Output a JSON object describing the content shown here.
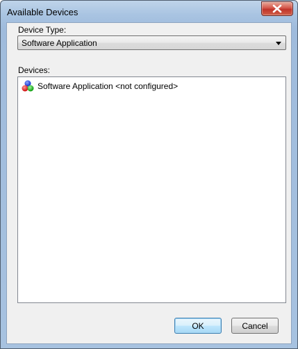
{
  "window": {
    "title": "Available Devices",
    "close_glyph": "x"
  },
  "device_type": {
    "label": "Device Type:",
    "selected": "Software Application"
  },
  "devices": {
    "label": "Devices:",
    "items": [
      {
        "icon": "rgb-spheres-icon",
        "label": "Software Application <not configured>"
      }
    ]
  },
  "buttons": {
    "ok": "OK",
    "cancel": "Cancel"
  },
  "colors": {
    "title_bar": "#a9c4e2",
    "close_button": "#c0342a",
    "dialog_background": "#f0f0f0",
    "icon_red": "#e02020",
    "icon_green": "#20b020",
    "icon_blue": "#2040e0"
  }
}
